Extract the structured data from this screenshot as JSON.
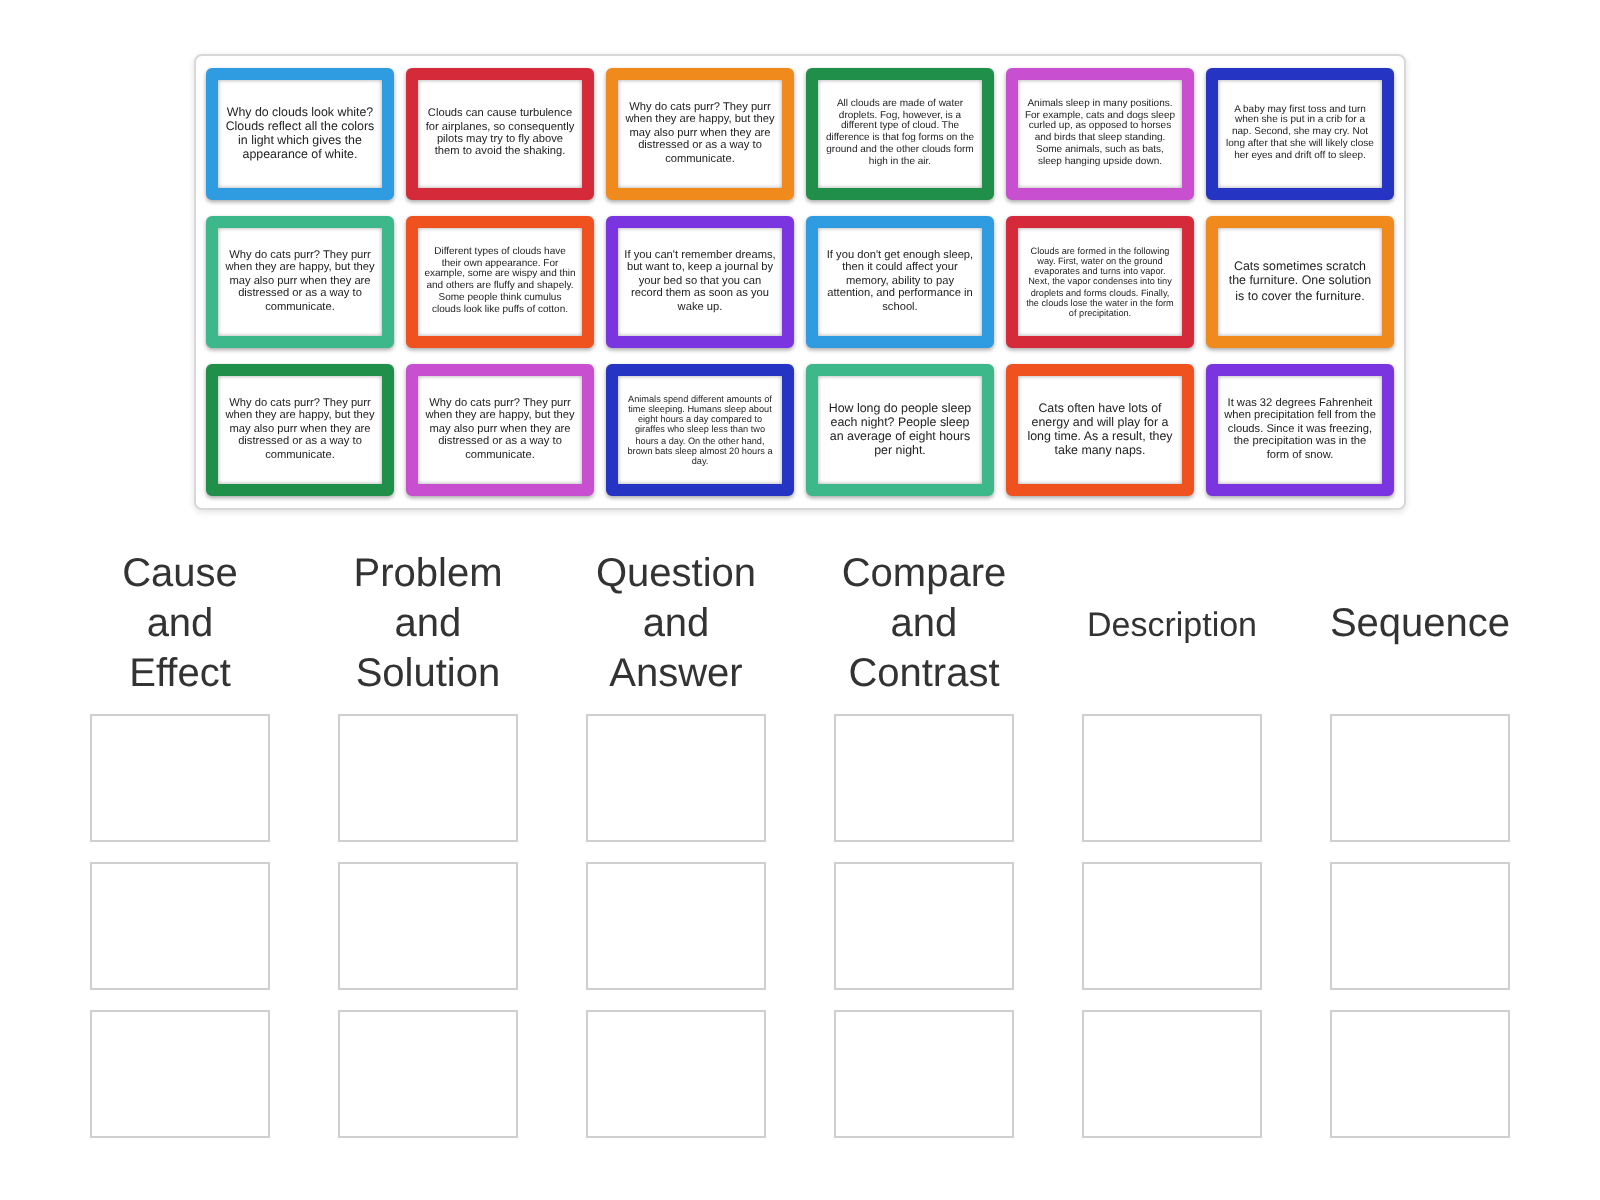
{
  "cards": [
    {
      "text": "Why do clouds look white? Clouds reflect all the colors in light which gives the appearance of white.",
      "color": "#2f9be0"
    },
    {
      "text": "Clouds can cause turbulence for airplanes, so consequently pilots may try to fly above them to avoid the shaking.",
      "color": "#d42a3a"
    },
    {
      "text": "Why do cats purr? They purr when they are happy, but they may also purr when they are distressed or as a way to communicate.",
      "color": "#f08a1c"
    },
    {
      "text": "All clouds are made of water droplets. Fog, however, is a different type of cloud. The difference is that fog forms on the ground and the other clouds form high in the air.",
      "color": "#1f8f4a"
    },
    {
      "text": "Animals sleep in many positions. For example, cats and dogs sleep curled up, as opposed to horses and birds that sleep standing. Some animals, such as bats, sleep hanging upside down.",
      "color": "#c84fd0"
    },
    {
      "text": "A baby may first toss and turn when she is put in a crib for a nap. Second, she may cry. Not long after that she will likely close her eyes and drift off to sleep.",
      "color": "#2634c4"
    },
    {
      "text": "Why do cats purr? They purr when they are happy, but they may also purr when they are distressed or as a way to communicate.",
      "color": "#3cb88a"
    },
    {
      "text": "Different types of clouds have their own appearance. For example, some are wispy and thin and others are fluffy and shapely. Some people think cumulus clouds look like puffs of cotton.",
      "color": "#f0521f"
    },
    {
      "text": "If you can't remember dreams, but want to, keep a journal by your bed so that you can record them as soon as you wake up.",
      "color": "#7b35e0"
    },
    {
      "text": "If you don't get enough sleep, then it could affect your memory, ability to pay attention, and performance in school.",
      "color": "#2f9be0"
    },
    {
      "text": "Clouds are formed in the following way. First, water on the ground evaporates and turns into vapor. Next, the vapor condenses into tiny droplets and forms clouds. Finally, the clouds lose the water in the form of precipitation.",
      "color": "#d42a3a"
    },
    {
      "text": "Cats sometimes scratch the furniture. One solution is to cover the furniture.",
      "color": "#f08a1c"
    },
    {
      "text": "Why do cats purr? They purr when they are happy, but they may also purr when they are distressed or as a way to communicate.",
      "color": "#1f8f4a"
    },
    {
      "text": "Why do cats purr? They purr when they are happy, but they may also purr when they are distressed or as a way to communicate.",
      "color": "#c84fd0"
    },
    {
      "text": "Animals spend different amounts of time sleeping. Humans sleep about eight hours a day compared to giraffes who sleep less than two hours a day. On the other hand, brown bats sleep almost 20 hours a day.",
      "color": "#2634c4"
    },
    {
      "text": "How long do people sleep each night? People sleep an average of eight hours per night.",
      "color": "#3cb88a"
    },
    {
      "text": "Cats often have lots of energy and will play for a long time. As a result, they take many naps.",
      "color": "#f0521f"
    },
    {
      "text": "It was 32 degrees Fahrenheit when precipitation fell from the clouds. Since it was freezing, the precipitation was in the form of snow.",
      "color": "#7b35e0"
    }
  ],
  "columns": [
    "Cause and Effect",
    "Problem and Solution",
    "Question and Answer",
    "Compare and Contrast",
    "Description",
    "Sequence"
  ]
}
